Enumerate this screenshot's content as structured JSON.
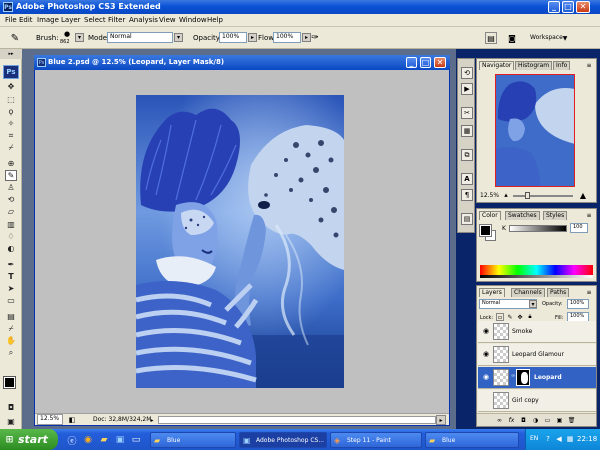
{
  "app": {
    "title": "Adobe Photoshop CS3 Extended",
    "logo": "Ps"
  },
  "menu": [
    "File",
    "Edit",
    "Image",
    "Layer",
    "Select",
    "Filter",
    "Analysis",
    "View",
    "Window",
    "Help"
  ],
  "options": {
    "brush_label": "Brush:",
    "brush_size": "862",
    "mode_label": "Mode:",
    "mode_value": "Normal",
    "opacity_label": "Opacity:",
    "opacity_value": "100%",
    "flow_label": "Flow:",
    "flow_value": "100%",
    "workspace_label": "Workspace"
  },
  "document": {
    "title": "Blue 2.psd @ 12.5% (Leopard, Layer Mask/8)",
    "zoom": "12.5%",
    "doc_info": "Doc: 32,8M/324,2M"
  },
  "navigator": {
    "tabs": [
      "Navigator",
      "Histogram",
      "Info"
    ],
    "zoom": "12.5%"
  },
  "color_panel": {
    "tabs": [
      "Color",
      "Swatches",
      "Styles"
    ],
    "channel_label": "K",
    "channel_value": "100"
  },
  "layers_panel": {
    "tabs": [
      "Layers",
      "Channels",
      "Paths"
    ],
    "blend_mode": "Normal",
    "opacity_label": "Opacity:",
    "opacity_value": "100%",
    "lock_label": "Lock:",
    "fill_label": "Fill:",
    "fill_value": "100%",
    "layers": [
      {
        "name": "Smoke",
        "selected": false
      },
      {
        "name": "Leopard Glamour",
        "selected": false
      },
      {
        "name": "Leopard",
        "selected": true
      },
      {
        "name": "Girl copy",
        "selected": false
      }
    ]
  },
  "taskbar": {
    "start_label": "start",
    "buttons": [
      "Blue",
      "Adobe Photoshop CS...",
      "Step 11 - Paint",
      "Blue"
    ],
    "language": "EN",
    "clock": "22:18"
  },
  "colors": {
    "foreground": "#000000",
    "background": "#ffffff",
    "accent": "#0a48c4"
  }
}
